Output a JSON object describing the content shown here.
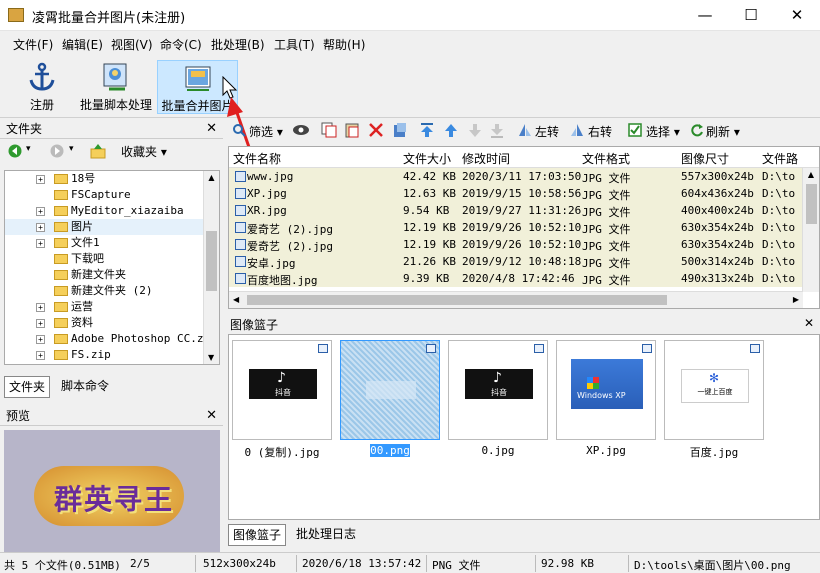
{
  "window": {
    "title": "凌霄批量合并图片(未注册)",
    "minimize": "—",
    "maximize": "☐",
    "close": "✕"
  },
  "menu": [
    "文件(F)",
    "编辑(E)",
    "视图(V)",
    "命令(C)",
    "批处理(B)",
    "工具(T)",
    "帮助(H)"
  ],
  "toolbar": {
    "register": "注册",
    "batch_script": "批量脚本处理",
    "batch_merge": "批量合并图片"
  },
  "folder_panel": {
    "title": "文件夹",
    "favorites": "收藏夹",
    "tree": [
      {
        "label": "18号",
        "expandable": true
      },
      {
        "label": "FSCapture",
        "expandable": false
      },
      {
        "label": "MyEditor_xiazaiba",
        "expandable": true
      },
      {
        "label": "图片",
        "expandable": true
      },
      {
        "label": "文件1",
        "expandable": true
      },
      {
        "label": "下载吧",
        "expandable": false
      },
      {
        "label": "新建文件夹",
        "expandable": false
      },
      {
        "label": "新建文件夹 (2)",
        "expandable": false
      },
      {
        "label": "运营",
        "expandable": true
      },
      {
        "label": "资料",
        "expandable": true
      },
      {
        "label": "Adobe Photoshop CC.zip",
        "expandable": true
      },
      {
        "label": "FS.zip",
        "expandable": true
      }
    ],
    "tabs": [
      "文件夹",
      "脚本命令"
    ]
  },
  "preview_panel": {
    "title": "预览",
    "logo_text": "群英寻王"
  },
  "file_toolbar": {
    "filter": "筛选",
    "rotate_left": "左转",
    "rotate_right": "右转",
    "select": "选择",
    "refresh": "刷新"
  },
  "file_list": {
    "columns": [
      "文件名称",
      "文件大小",
      "修改时间",
      "文件格式",
      "图像尺寸",
      "文件路"
    ],
    "rows": [
      [
        "www.jpg",
        "42.42 KB",
        "2020/3/11 17:03:50",
        "JPG 文件",
        "557x300x24b",
        "D:\\to"
      ],
      [
        "XP.jpg",
        "12.63 KB",
        "2019/9/15 10:58:56",
        "JPG 文件",
        "604x436x24b",
        "D:\\to"
      ],
      [
        "XR.jpg",
        "9.54 KB",
        "2019/9/27 11:31:26",
        "JPG 文件",
        "400x400x24b",
        "D:\\to"
      ],
      [
        "爱奇艺 (2).jpg",
        "12.19 KB",
        "2019/9/26 10:52:10",
        "JPG 文件",
        "630x354x24b",
        "D:\\to"
      ],
      [
        "爱奇艺 (2).jpg",
        "12.19 KB",
        "2019/9/26 10:52:10",
        "JPG 文件",
        "630x354x24b",
        "D:\\to"
      ],
      [
        "安卓.jpg",
        "21.26 KB",
        "2019/9/12 10:48:18",
        "JPG 文件",
        "500x314x24b",
        "D:\\to"
      ],
      [
        "百度地图.jpg",
        "9.39 KB",
        "2020/4/8 17:42:46",
        "JPG 文件",
        "490x313x24b",
        "D:\\to"
      ]
    ]
  },
  "basket": {
    "title": "图像篮子",
    "items": [
      {
        "name": "0 (复制).jpg",
        "kind": "tiktok"
      },
      {
        "name": "00.png",
        "kind": "selected"
      },
      {
        "name": "0.jpg",
        "kind": "tiktok"
      },
      {
        "name": "XP.jpg",
        "kind": "xp"
      },
      {
        "name": "百度.jpg",
        "kind": "baidu"
      }
    ],
    "tiktok_caption": "抖音",
    "baidu_caption": "一键上百度",
    "xp_caption": "Windows XP",
    "tabs": [
      "图像篮子",
      "批处理日志"
    ]
  },
  "status": {
    "count": "共 5 个文件(0.51MB)",
    "index": "2/5",
    "dims": "512x300x24b",
    "date": "2020/6/18 13:57:42",
    "format": "PNG 文件",
    "size": "92.98 KB",
    "path": "D:\\tools\\桌面\\图片\\00.png"
  },
  "colors": {
    "accent": "#cce8ff",
    "row_bg": "#f1f0d9",
    "arrow": "#e02020",
    "selection": "#3399ff"
  }
}
